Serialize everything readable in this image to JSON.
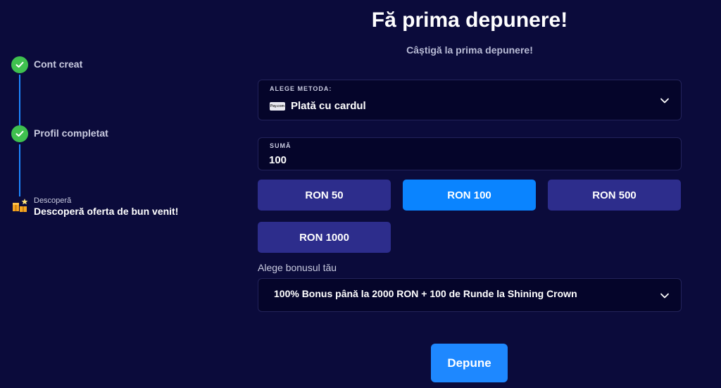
{
  "stepper": {
    "steps": [
      {
        "label": "Cont creat",
        "status": "done"
      },
      {
        "label": "Profil completat",
        "status": "done"
      },
      {
        "small": "Descoperă",
        "label": "Descoperă oferta de bun venit!",
        "status": "current"
      }
    ],
    "done_color": "#3fc14f",
    "line_color": "#1e88ff"
  },
  "main": {
    "title": "Fă prima depunere!",
    "subtitle": "Câștigă la prima depunere!",
    "method": {
      "label": "ALEGE METODA:",
      "logo_text": "Pay.com",
      "value": "Plată cu cardul",
      "icon": "chevron-down-icon"
    },
    "amount": {
      "label": "SUMĂ",
      "value": "100"
    },
    "chips": [
      {
        "label": "RON 50",
        "active": false
      },
      {
        "label": "RON 100",
        "active": true
      },
      {
        "label": "RON 500",
        "active": false
      },
      {
        "label": "RON 1000",
        "active": false
      }
    ],
    "bonus": {
      "label": "Alege bonusul tău",
      "value": "100% Bonus până la 2000 RON + 100 de Runde la Shining Crown",
      "icon": "chevron-down-icon"
    },
    "deposit_label": "Depune"
  },
  "colors": {
    "background": "#0b0b3b",
    "accent": "#0a84ff",
    "chip": "#2d2d8c",
    "field": "#05052a"
  }
}
